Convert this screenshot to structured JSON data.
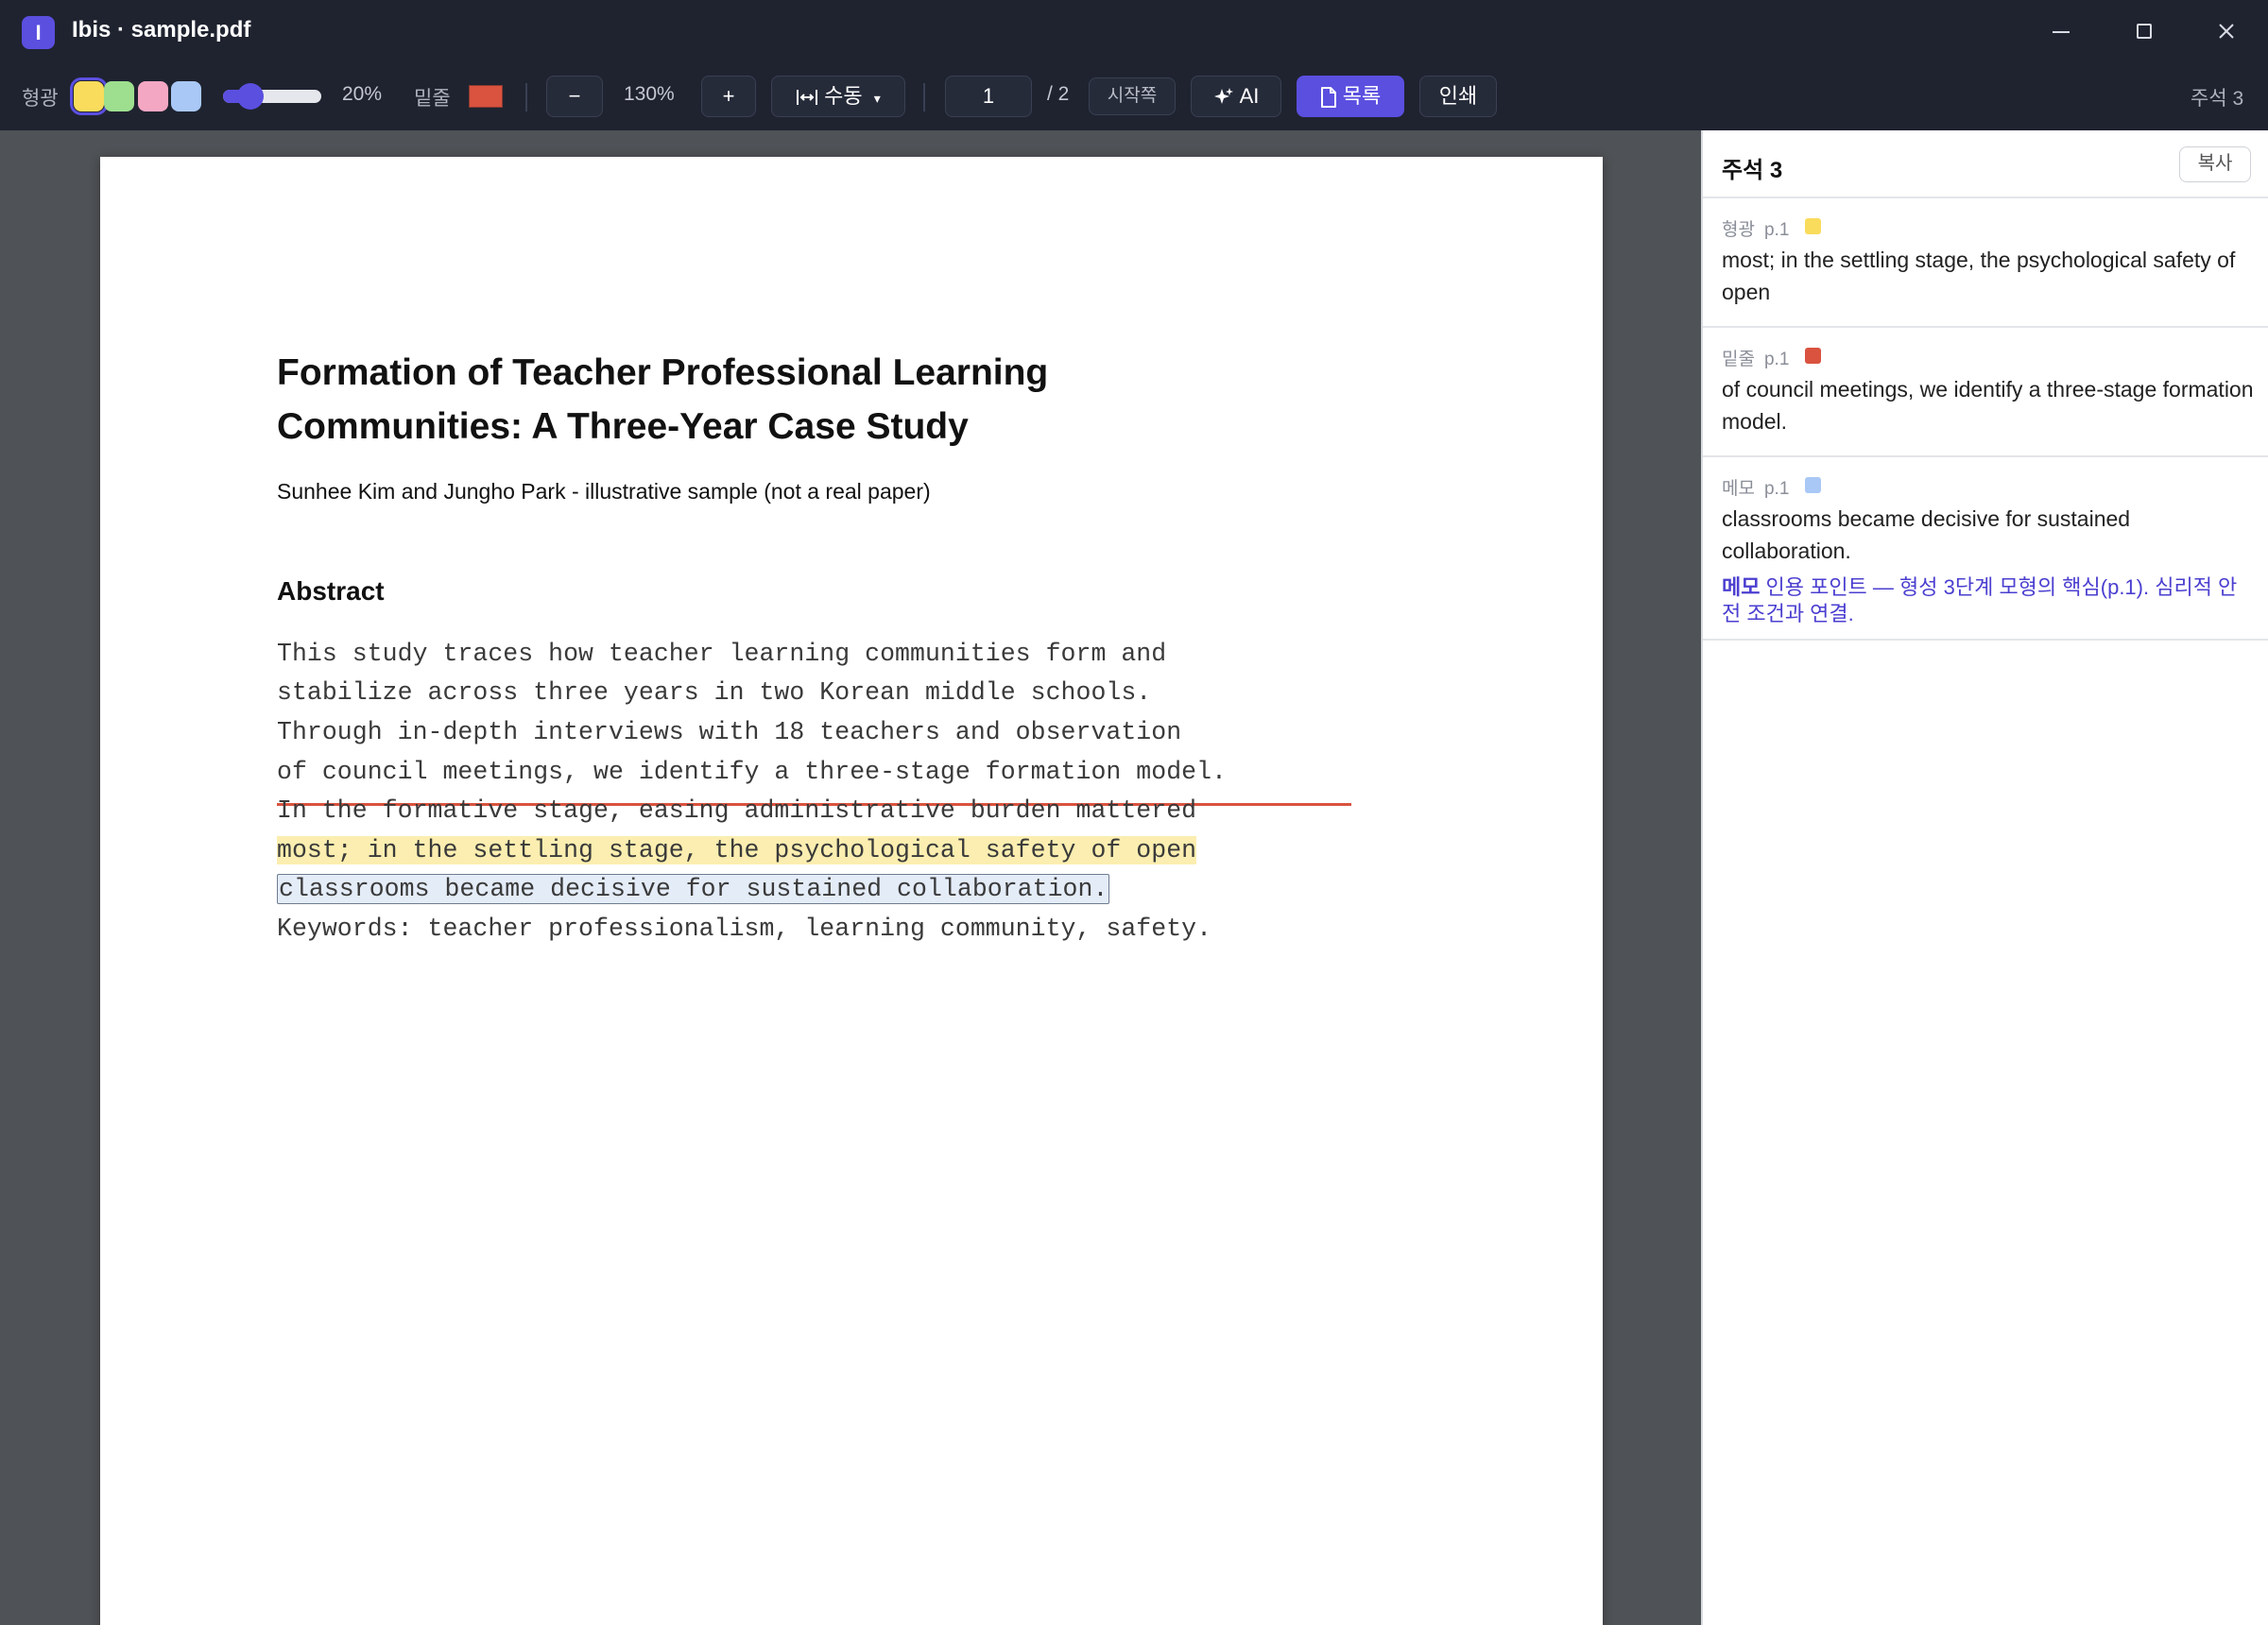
{
  "window": {
    "badge": "I",
    "title": "Ibis · sample.pdf"
  },
  "toolbar": {
    "highlight_label": "형광",
    "swatches": [
      {
        "name": "yellow",
        "color": "#f9dc5c",
        "selected": true
      },
      {
        "name": "green",
        "color": "#9ddf8f",
        "selected": false
      },
      {
        "name": "pink",
        "color": "#f4a7c3",
        "selected": false
      },
      {
        "name": "blue",
        "color": "#a9c8f6",
        "selected": false
      }
    ],
    "opacity_value": "20%",
    "opacity_fraction": 0.2,
    "underline_label": "밑줄",
    "underline_color": "#d9533f",
    "zoom_out": "−",
    "zoom_value": "130%",
    "zoom_in": "+",
    "fit_mode": "수동",
    "fit_mode_caret": "▾",
    "page_current": "1",
    "page_total": "/ 2",
    "start_page": "시작쪽",
    "ai_button": "AI",
    "toc_button": "목록",
    "print_button": "인쇄",
    "annotation_count": "주석 3"
  },
  "document": {
    "title_line1": "Formation of Teacher Professional Learning",
    "title_line2": "Communities: A Three-Year Case Study",
    "authors": "Sunhee Kim and Jungho Park  -  illustrative sample (not a real paper)",
    "abstract_heading": "Abstract",
    "abstract_lines": [
      "This study traces how teacher learning communities form and",
      "stabilize across three years in two Korean middle schools.",
      "Through in-depth interviews with 18 teachers and observation",
      "of council meetings, we identify a three-stage formation model.",
      "In the formative stage, easing administrative burden mattered",
      "most; in the settling stage, the psychological safety of open",
      "classrooms became decisive for sustained collaboration.",
      "Keywords: teacher professionalism, learning community, safety."
    ]
  },
  "panel": {
    "title": "주석 3",
    "copy_button": "복사",
    "annotations": [
      {
        "type": "형광",
        "page": "p.1",
        "color": "#f9dc5c",
        "text": "most; in the settling stage, the psychological safety of open"
      },
      {
        "type": "밑줄",
        "page": "p.1",
        "color": "#d9533f",
        "text": "of council meetings, we identify a three-stage formation model."
      },
      {
        "type": "메모",
        "page": "p.1",
        "color": "#a9c8f6",
        "text": "classrooms became decisive for sustained collaboration.",
        "memo_label": "메모",
        "memo_text": "인용 포인트 — 형성 3단계 모형의 핵심(p.1). 심리적 안전 조건과 연결."
      }
    ]
  }
}
